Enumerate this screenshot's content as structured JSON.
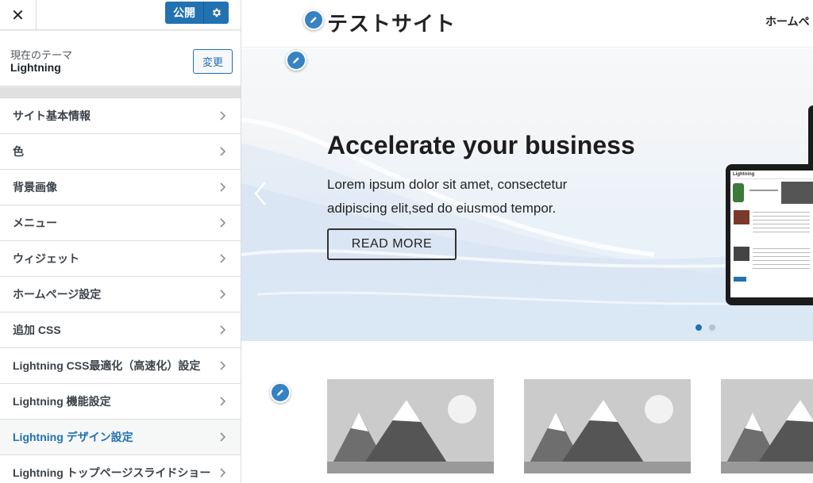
{
  "sidebar": {
    "close_icon": "close-icon",
    "publish_label": "公開",
    "publish_gear_icon": "gear-icon",
    "theme": {
      "label": "現在のテーマ",
      "name": "Lightning",
      "change_label": "変更"
    },
    "items": [
      {
        "label": "サイト基本情報"
      },
      {
        "label": "色"
      },
      {
        "label": "背景画像"
      },
      {
        "label": "メニュー"
      },
      {
        "label": "ウィジェット"
      },
      {
        "label": "ホームページ設定"
      },
      {
        "label": "追加 CSS"
      },
      {
        "label": "Lightning CSS最適化（高速化）設定"
      },
      {
        "label": "Lightning 機能設定"
      },
      {
        "label": "Lightning デザイン設定"
      },
      {
        "label": "Lightning トップページスライドショー"
      }
    ],
    "active_item": "Lightning デザイン設定"
  },
  "preview": {
    "site_title": "テストサイト",
    "nav": {
      "home": "ホームペ"
    },
    "hero": {
      "title": "Accelerate your business",
      "text": "Lorem ipsum dolor sit amet, consectetur adipiscing elit,sed do eiusmod tempor.",
      "button": "READ MORE",
      "active_slide": 1,
      "slide_count": 2
    },
    "tablet": {
      "brand": "Lightning"
    }
  },
  "colors": {
    "accent": "#2271b1",
    "pencil": "#3582c4",
    "active_text": "#2271b1"
  }
}
